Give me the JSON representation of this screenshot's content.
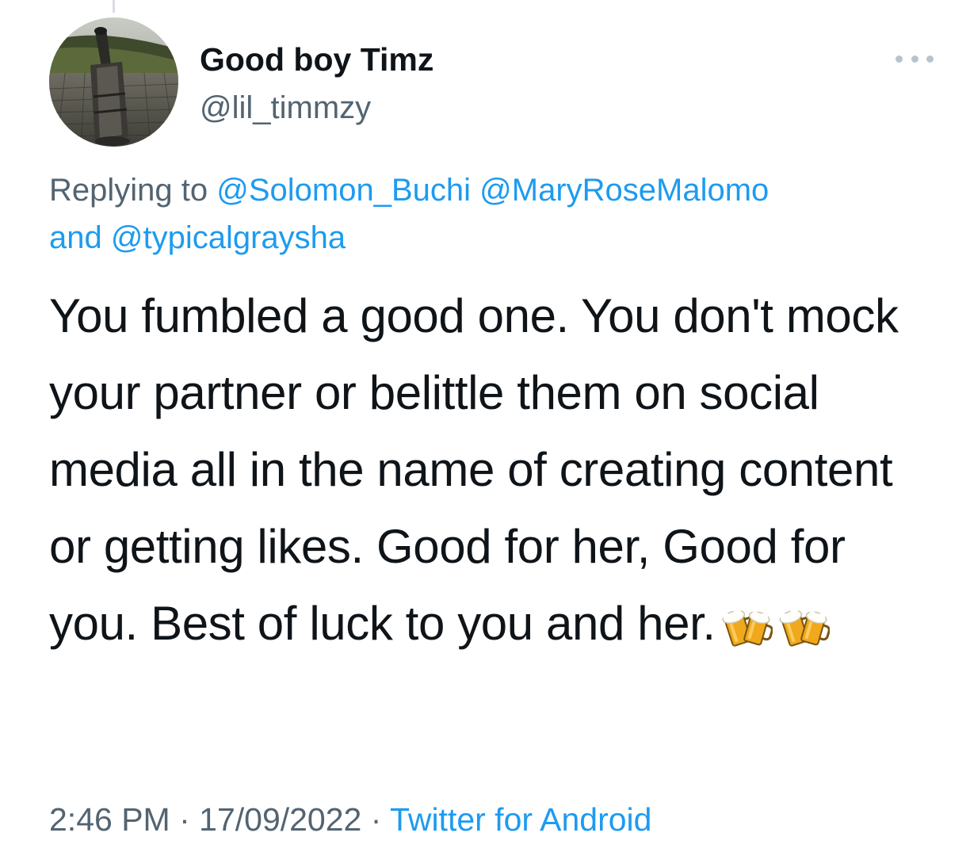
{
  "author": {
    "display_name": "Good boy Timz",
    "handle": "@lil_timmzy",
    "avatar_icon": "avatar-photo"
  },
  "reply": {
    "prefix": "Replying to ",
    "mentions": [
      "@Solomon_Buchi",
      "@MaryRoseMalomo",
      "@typicalgraysha"
    ],
    "conjunction": "and "
  },
  "tweet": {
    "text": "You fumbled a good one. You don't mock your partner or belittle them on social media all in the name of creating content or getting likes. Good for her, Good for you. Best of luck to you and her.",
    "emojis": [
      "beer-mugs-icon",
      "beer-mugs-icon"
    ]
  },
  "meta": {
    "time": "2:46 PM",
    "separator": " · ",
    "date": "17/09/2022",
    "source": "Twitter for Android"
  },
  "colors": {
    "link": "#1d9bf0",
    "secondary_text": "#536471",
    "primary_text": "#0f1419"
  }
}
